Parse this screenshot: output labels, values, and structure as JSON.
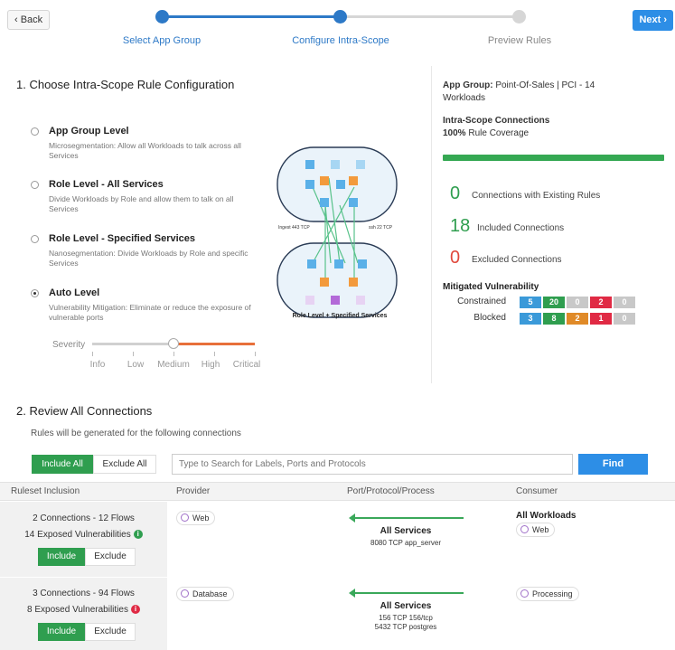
{
  "header": {
    "back_label": "‹ Back",
    "next_label": "Next ›",
    "steps": [
      {
        "label": "Select App Group"
      },
      {
        "label": "Configure Intra-Scope"
      },
      {
        "label": "Preview Rules"
      }
    ]
  },
  "section1": {
    "title": "1. Choose Intra-Scope Rule Configuration",
    "options": [
      {
        "title": "App Group Level",
        "desc": "Microsegmentation: Allow all Workloads to talk across all Services",
        "selected": false
      },
      {
        "title": "Role Level - All Services",
        "desc": "Divide Workloads by Role and allow them to talk on all Services",
        "selected": false
      },
      {
        "title": "Role Level - Specified Services",
        "desc": "Nanosegmentation: Divide Workloads by Role and specific Services",
        "selected": false
      },
      {
        "title": "Auto Level",
        "desc": "Vulnerability Mitigation: Eliminate or reduce the exposure of vulnerable ports",
        "selected": true
      }
    ],
    "severity": {
      "label": "Severity",
      "ticks": [
        "Info",
        "Low",
        "Medium",
        "High",
        "Critical"
      ],
      "selected": "Medium"
    },
    "diagram": {
      "left_label": "Ingest 443 TCP",
      "right_label": "ssh 22 TCP",
      "caption": "Role Level + Specified Services"
    }
  },
  "panel": {
    "app_group_label": "App Group:",
    "app_group_value": "Point-Of-Sales | PCI - 14",
    "app_group_value2": "Workloads",
    "intra_title": "Intra-Scope Connections",
    "coverage_pct": "100%",
    "coverage_text": "Rule Coverage",
    "coverage_value": 1.0,
    "counts": [
      {
        "num": "0",
        "text": "Connections with Existing Rules",
        "color": "#2f9e4f"
      },
      {
        "num": "18",
        "text": "Included Connections",
        "color": "#2f9e4f"
      },
      {
        "num": "0",
        "text": "Excluded Connections",
        "color": "#e0483c"
      }
    ],
    "mv_title": "Mitigated Vulnerability",
    "mv_rows": [
      {
        "label": "Constrained",
        "cells": [
          "5",
          "20",
          "0",
          "2",
          "0"
        ]
      },
      {
        "label": "Blocked",
        "cells": [
          "3",
          "8",
          "2",
          "1",
          "0"
        ]
      }
    ],
    "mv_colors": [
      "#3b9ad9",
      "#2f9e4f",
      "#c8c8c8",
      "#e02a44",
      "#c8c8c8"
    ],
    "mv_colors_blocked": [
      "#3b9ad9",
      "#2f9e4f",
      "#e08a28",
      "#e02a44",
      "#c8c8c8"
    ]
  },
  "section2": {
    "title": "2. Review All Connections",
    "subtitle": "Rules will be generated for the following connections",
    "include_all": "Include All",
    "exclude_all": "Exclude All",
    "search_placeholder": "Type to Search for Labels, Ports and Protocols",
    "find_label": "Find",
    "columns": [
      "Ruleset Inclusion",
      "Provider",
      "Port/Protocol/Process",
      "Consumer"
    ],
    "rows": [
      {
        "connections": "2 Connections - 12 Flows",
        "vulns": "14 Exposed Vulnerabilities",
        "vuln_color": "#2f9e4f",
        "include": "Include",
        "exclude": "Exclude",
        "provider": "Web",
        "service": "All Services",
        "ports": [
          "8080 TCP app_server"
        ],
        "consumer_title": "All Workloads",
        "consumer": "Web"
      },
      {
        "connections": "3 Connections - 94 Flows",
        "vulns": "8 Exposed Vulnerabilities",
        "vuln_color": "#e02a44",
        "include": "Include",
        "exclude": "Exclude",
        "provider": "Database",
        "service": "All Services",
        "ports": [
          "156 TCP 156/tcp",
          "5432 TCP postgres"
        ],
        "consumer_title": "",
        "consumer": "Processing"
      }
    ]
  }
}
